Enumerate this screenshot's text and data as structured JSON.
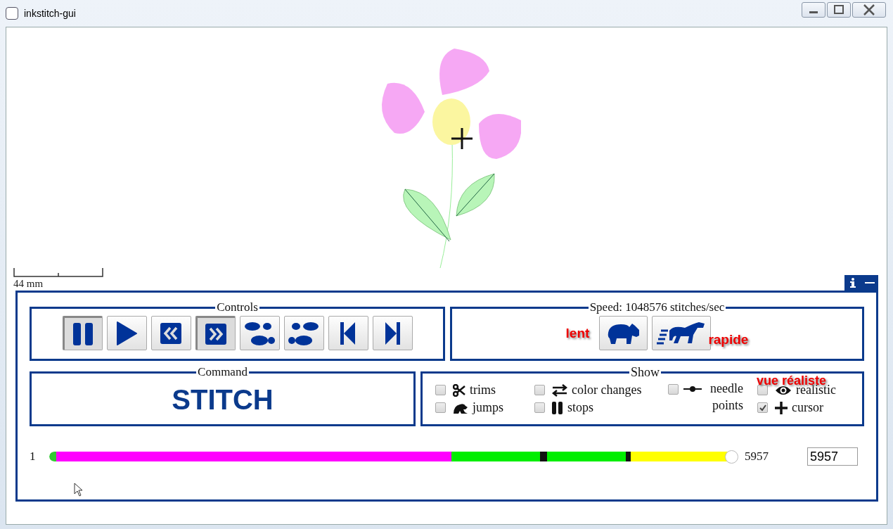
{
  "window": {
    "title": "inkstitch-gui"
  },
  "canvas": {
    "scale_label": "44 mm"
  },
  "controls": {
    "title": "Controls",
    "buttons": [
      {
        "kind": "pause",
        "pressed": true
      },
      {
        "kind": "play",
        "pressed": false
      },
      {
        "kind": "reverse",
        "pressed": false
      },
      {
        "kind": "forward",
        "pressed": true
      },
      {
        "kind": "step-back",
        "pressed": false
      },
      {
        "kind": "step-forward",
        "pressed": false
      },
      {
        "kind": "first",
        "pressed": false
      },
      {
        "kind": "last",
        "pressed": false
      }
    ]
  },
  "speed": {
    "title": "Speed: 1048576 stitches/sec",
    "slow_label": "lent",
    "fast_label": "rapide",
    "buttons": [
      {
        "kind": "slower"
      },
      {
        "kind": "faster"
      }
    ]
  },
  "command": {
    "title": "Command",
    "value": "STITCH"
  },
  "show": {
    "title": "Show",
    "annotation": "vue réaliste",
    "options": [
      {
        "kind": "trims",
        "label": "trims",
        "checked": false
      },
      {
        "kind": "color-changes",
        "label": "color changes",
        "checked": false
      },
      {
        "kind": "needle-points",
        "label": "needle points",
        "checked": false
      },
      {
        "kind": "realistic",
        "label": "realistic",
        "checked": false
      },
      {
        "kind": "jumps",
        "label": "jumps",
        "checked": false
      },
      {
        "kind": "stops",
        "label": "stops",
        "checked": false
      },
      {
        "kind": "cursor",
        "label": "cursor",
        "checked": true
      }
    ]
  },
  "timeline": {
    "start": "1",
    "end": "5957",
    "level": 1,
    "value": "5957"
  }
}
